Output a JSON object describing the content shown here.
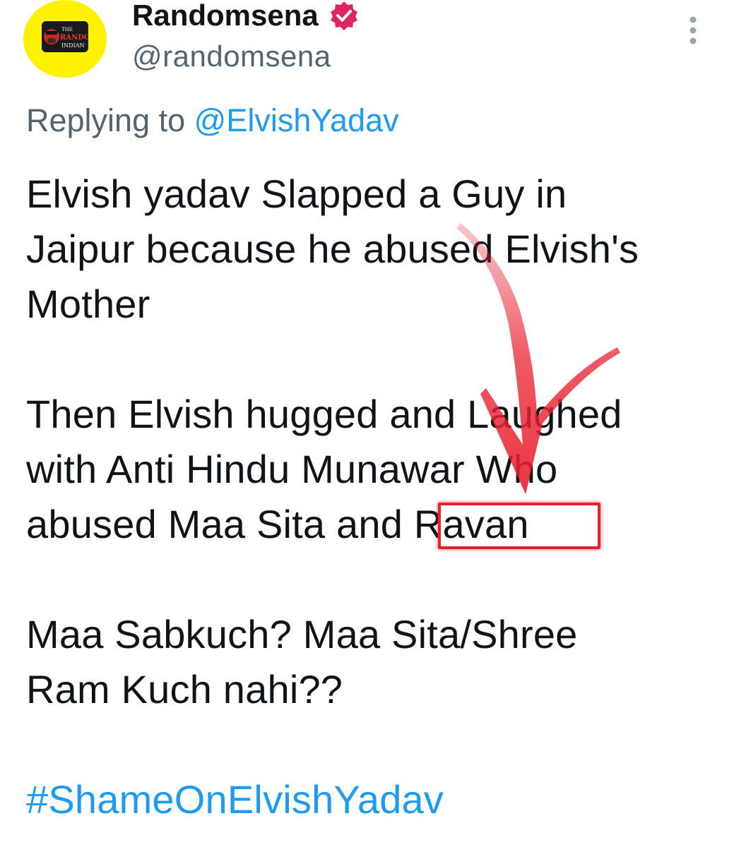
{
  "author": {
    "display_name": "Randomsena",
    "handle": "@randomsena",
    "avatar_icon": "random-indian-logo",
    "avatar_logo_text": [
      "THE",
      "RANDOM",
      "INDIAN"
    ],
    "verified": true,
    "verified_color": "#e0245e"
  },
  "reply": {
    "prefix": "Replying to",
    "mention": "@ElvishYadav"
  },
  "tweet": {
    "paragraphs": [
      [
        "Elvish yadav Slapped a Guy in",
        "Jaipur because he abused Elvish's",
        "Mother"
      ],
      [
        "Then Elvish hugged and Laughed",
        "with Anti Hindu Munawar Who",
        "abused Maa Sita and Ravan"
      ],
      [
        "Maa Sabkuch? Maa Sita/Shree",
        "Ram Kuch nahi??"
      ]
    ],
    "hashtag": "#ShameOnElvishYadav"
  },
  "annotation": {
    "highlighted_word": "Ravan",
    "color": "#e8212f"
  },
  "colors": {
    "link": "#1d9bf0",
    "secondary_text": "#536471",
    "primary_text": "#0f1419",
    "avatar_bg": "#fff200"
  },
  "icons": {
    "more": "more-vertical-icon",
    "verified": "verified-badge-icon"
  }
}
